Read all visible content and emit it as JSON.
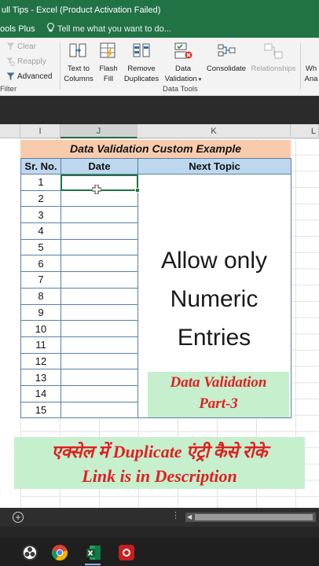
{
  "window": {
    "title": "ull Tips - Excel (Product Activation Failed)"
  },
  "tellbar": {
    "tools_plus": "ools Plus",
    "tell_me": "Tell me what you want to do..."
  },
  "ribbon": {
    "filter_items": [
      "Clear",
      "Reapply",
      "Advanced"
    ],
    "filter_group_label": "Filter",
    "data_tools_group_label": "Data Tools",
    "buttons": {
      "text_to_columns": [
        "Text to",
        "Columns"
      ],
      "flash_fill": [
        "Flash",
        "Fill"
      ],
      "remove_duplicates": [
        "Remove",
        "Duplicates"
      ],
      "data_validation": [
        "Data",
        "Validation"
      ],
      "consolidate": "Consolidate",
      "relationships": "Relationships",
      "what_if": [
        "Wh",
        "Ana"
      ]
    },
    "icons": [
      "clear-filter-icon",
      "reapply-icon",
      "advanced-filter-icon",
      "text-to-columns-icon",
      "flash-fill-icon",
      "remove-duplicates-icon",
      "data-validation-icon",
      "consolidate-icon",
      "relationships-icon"
    ]
  },
  "columns": [
    "I",
    "J",
    "K",
    "L"
  ],
  "active_column": "J",
  "sheet": {
    "title": "Data Validation Custom Example",
    "headers": [
      "Sr. No.",
      "Date",
      "Next Topic"
    ],
    "rows": [
      "1",
      "2",
      "3",
      "4",
      "5",
      "6",
      "7",
      "8",
      "9",
      "10",
      "11",
      "12",
      "13",
      "14",
      "15"
    ],
    "topic_lines": [
      "Allow only",
      "Numeric",
      "Entries"
    ],
    "part_lines": [
      "Data Validation",
      "Part-3"
    ]
  },
  "banner": {
    "line1": "एक्सेल में Duplicate एंट्री कैसे रोके",
    "line2": "Link is in Description"
  },
  "tabbar": {
    "add_sheet": "+",
    "dots": "⋮"
  },
  "colors": {
    "excel_green": "#217346",
    "title_fill": "#f8cbad",
    "header_fill": "#bdd7ee",
    "highlight_green": "#c6efce",
    "red_text": "#e02020"
  },
  "taskbar_icons": [
    "obs-icon",
    "chrome-icon",
    "screen-recorder-icon",
    "excel-icon",
    "record-icon"
  ]
}
